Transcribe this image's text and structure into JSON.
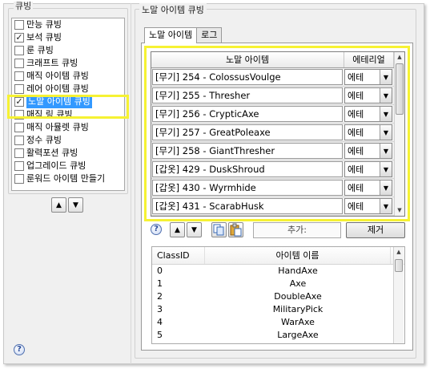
{
  "left": {
    "group_title": "큐빙",
    "categories": [
      {
        "label": "만능 큐빙",
        "checked": false
      },
      {
        "label": "보석 큐빙",
        "checked": true
      },
      {
        "label": "룬 큐빙",
        "checked": false
      },
      {
        "label": "크래프트 큐빙",
        "checked": false
      },
      {
        "label": "매직 아이템 큐빙",
        "checked": false
      },
      {
        "label": "레어 아이템 큐빙",
        "checked": false
      },
      {
        "label": "노말 아이템 큐빙",
        "checked": true
      },
      {
        "label": "매직 링 큐빙",
        "checked": false
      },
      {
        "label": "매직 아뮬렛 큐빙",
        "checked": false
      },
      {
        "label": "정수 큐빙",
        "checked": false
      },
      {
        "label": "활력포션 큐빙",
        "checked": false
      },
      {
        "label": "업그레이드 큐빙",
        "checked": false
      },
      {
        "label": "룬워드 아이템 만들기",
        "checked": false
      }
    ],
    "up_symbol": "▲",
    "down_symbol": "▼",
    "help_symbol": "?"
  },
  "right": {
    "group_title": "노말 아이템 큐빙",
    "tabs": [
      "노말 아이템",
      "로그"
    ],
    "grid": {
      "headers": [
        "노말 아이템",
        "에테리얼"
      ],
      "rows": [
        {
          "name": "[무기] 254 - ColossusVoulge",
          "ethereal": "에테"
        },
        {
          "name": "[무기] 255 - Thresher",
          "ethereal": "에테"
        },
        {
          "name": "[무기] 256 - CrypticAxe",
          "ethereal": "에테"
        },
        {
          "name": "[무기] 257 - GreatPoleaxe",
          "ethereal": "에테"
        },
        {
          "name": "[무기] 258 - GiantThresher",
          "ethereal": "에테"
        },
        {
          "name": "[갑옷] 429 - DuskShroud",
          "ethereal": "에테"
        },
        {
          "name": "[갑옷] 430 - Wyrmhide",
          "ethereal": "에테"
        },
        {
          "name": "[갑옷] 431 - ScarabHusk",
          "ethereal": "에테"
        }
      ]
    },
    "toolbar": {
      "help_symbol": "?",
      "up_symbol": "▲",
      "down_symbol": "▼",
      "add_label": "추가:",
      "delete_label": "제거"
    },
    "list": {
      "headers": [
        "ClassID",
        "아이템 이름"
      ],
      "rows": [
        {
          "id": "0",
          "name": "HandAxe"
        },
        {
          "id": "1",
          "name": "Axe"
        },
        {
          "id": "2",
          "name": "DoubleAxe"
        },
        {
          "id": "3",
          "name": "MilitaryPick"
        },
        {
          "id": "4",
          "name": "WarAxe"
        },
        {
          "id": "5",
          "name": "LargeAxe"
        }
      ]
    }
  },
  "colors": {
    "highlight": "#f6f233",
    "selection": "#3399ff"
  }
}
